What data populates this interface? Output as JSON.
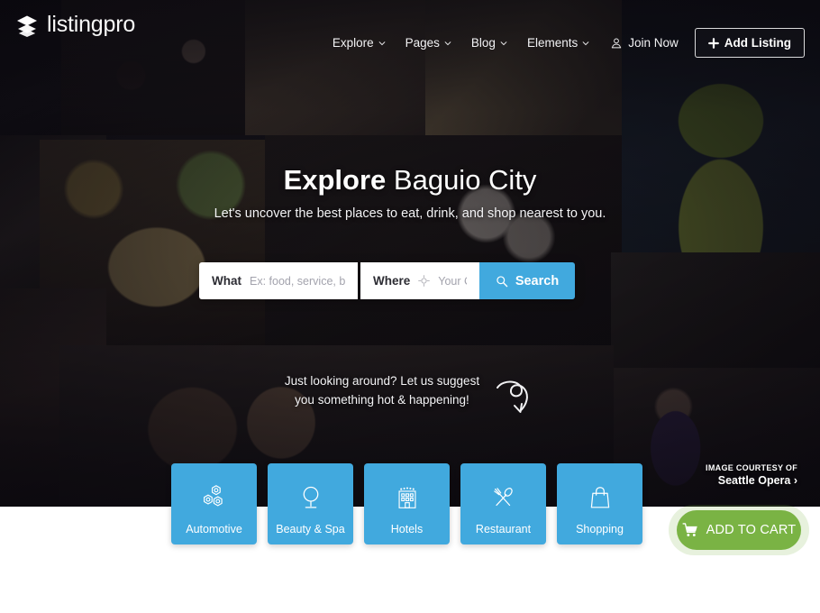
{
  "brand": {
    "name": "listingpro",
    "logo_icon": "layers-icon",
    "accent_blue": "#41a9de",
    "accent_green": "#7ab344"
  },
  "header": {
    "nav": [
      {
        "label": "Explore",
        "icon": "chevron-down-icon",
        "name": "nav-explore"
      },
      {
        "label": "Pages",
        "icon": "chevron-down-icon",
        "name": "nav-pages"
      },
      {
        "label": "Blog",
        "icon": "chevron-down-icon",
        "name": "nav-blog"
      },
      {
        "label": "Elements",
        "icon": "chevron-down-icon",
        "name": "nav-elements"
      }
    ],
    "join": {
      "label": "Join Now",
      "icon": "user-icon"
    },
    "add_listing": {
      "label": "Add Listing",
      "icon": "plus-icon"
    }
  },
  "hero": {
    "title_bold": "Explore",
    "title_light": "Baguio City",
    "subtitle": "Let's uncover the best places to eat, drink, and shop nearest to you.",
    "suggest_line1": "Just looking around? Let us suggest",
    "suggest_line2": "you something hot & happening!",
    "suggest_icon": "curly-arrow-icon"
  },
  "search": {
    "what_label": "What",
    "what_placeholder": "Ex: food, service, barbe",
    "what_value": "",
    "where_label": "Where",
    "where_placeholder": "Your City...",
    "where_value": "",
    "where_icon": "crosshair-location-icon",
    "button_label": "Search",
    "button_icon": "search-icon"
  },
  "categories": [
    {
      "label": "Automotive",
      "icon": "gears-icon"
    },
    {
      "label": "Beauty & Spa",
      "icon": "vanity-mirror-icon"
    },
    {
      "label": "Hotels",
      "icon": "hotel-building-icon"
    },
    {
      "label": "Restaurant",
      "icon": "fork-knife-icon"
    },
    {
      "label": "Shopping",
      "icon": "shopping-bag-icon"
    }
  ],
  "courtesy": {
    "prefix": "IMAGE COURTESY OF",
    "name": "Seattle Opera ›"
  },
  "cart": {
    "label": "ADD TO CART",
    "icon": "shopping-cart-icon"
  }
}
